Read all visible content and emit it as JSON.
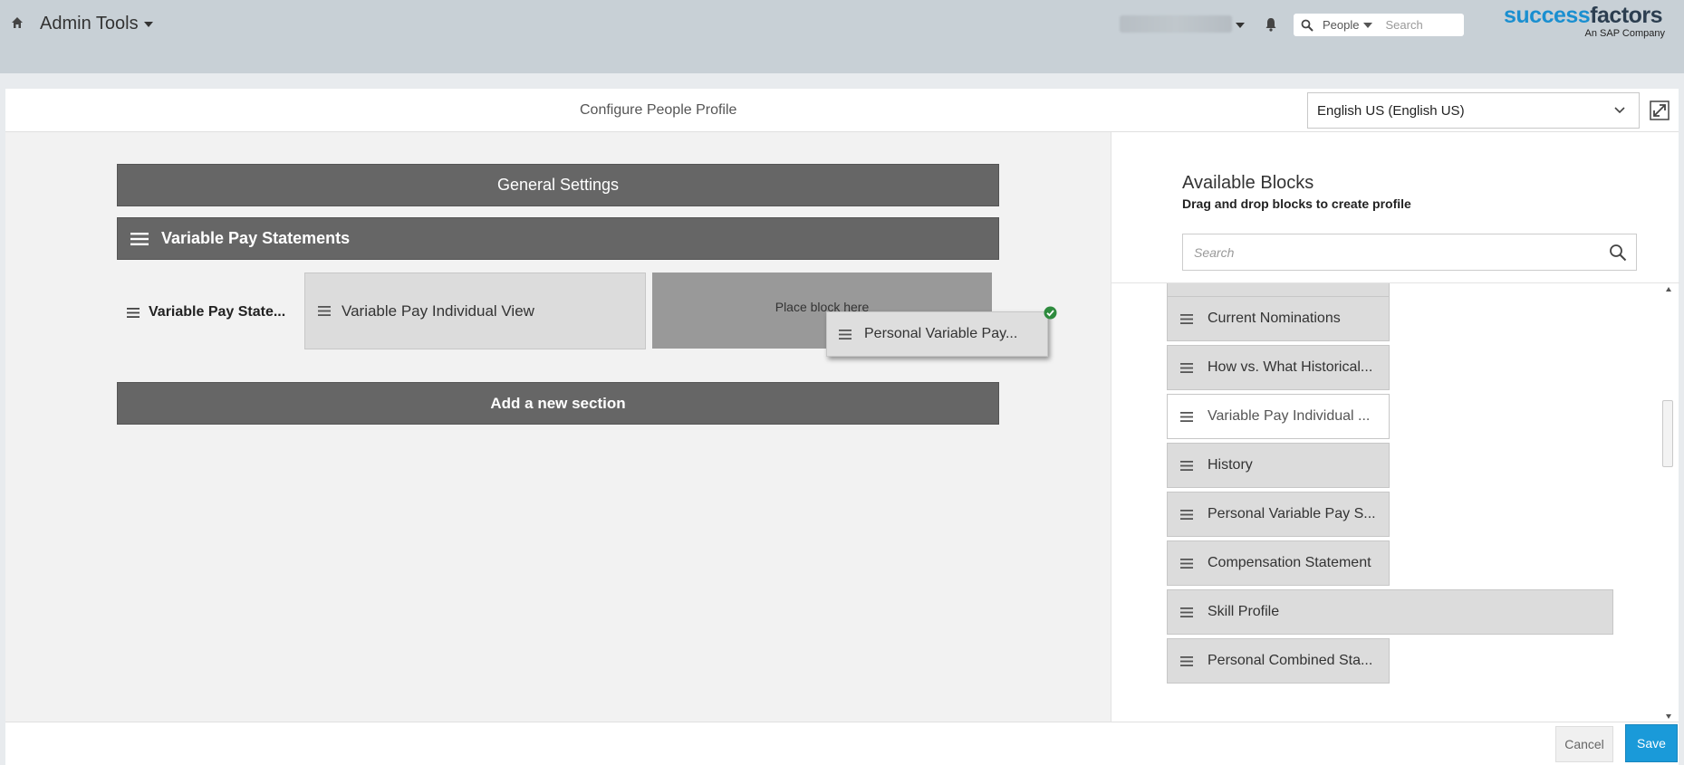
{
  "header": {
    "menu_title": "Admin Tools",
    "search_scope": "People",
    "search_placeholder": "Search",
    "logo_main_a": "success",
    "logo_main_b": "factors",
    "logo_sub": "An SAP Company"
  },
  "page": {
    "title": "Configure People Profile",
    "language": "English US (English US)"
  },
  "canvas": {
    "general_settings": "General Settings",
    "section_title": "Variable Pay Statements",
    "row_label": "Variable Pay State...",
    "block_1": "Variable Pay Individual View",
    "placeholder": "Place block here",
    "dragging_block": "Personal Variable Pay...",
    "add_section": "Add a new section"
  },
  "sidebar": {
    "title": "Available Blocks",
    "subtitle": "Drag and drop blocks to create profile",
    "search_placeholder": "Search",
    "items": [
      "Current Nominations",
      "How vs. What Historical...",
      "Variable Pay Individual ...",
      "History",
      "Personal Variable Pay S...",
      "Compensation Statement",
      "Skill Profile",
      "Personal Combined Sta..."
    ]
  },
  "footer": {
    "cancel": "Cancel",
    "save": "Save"
  },
  "colors": {
    "header_bg": "#c8d0d6",
    "dark_bar": "#666666",
    "primary": "#1a9ad9",
    "check_green": "#2e8b3e"
  }
}
